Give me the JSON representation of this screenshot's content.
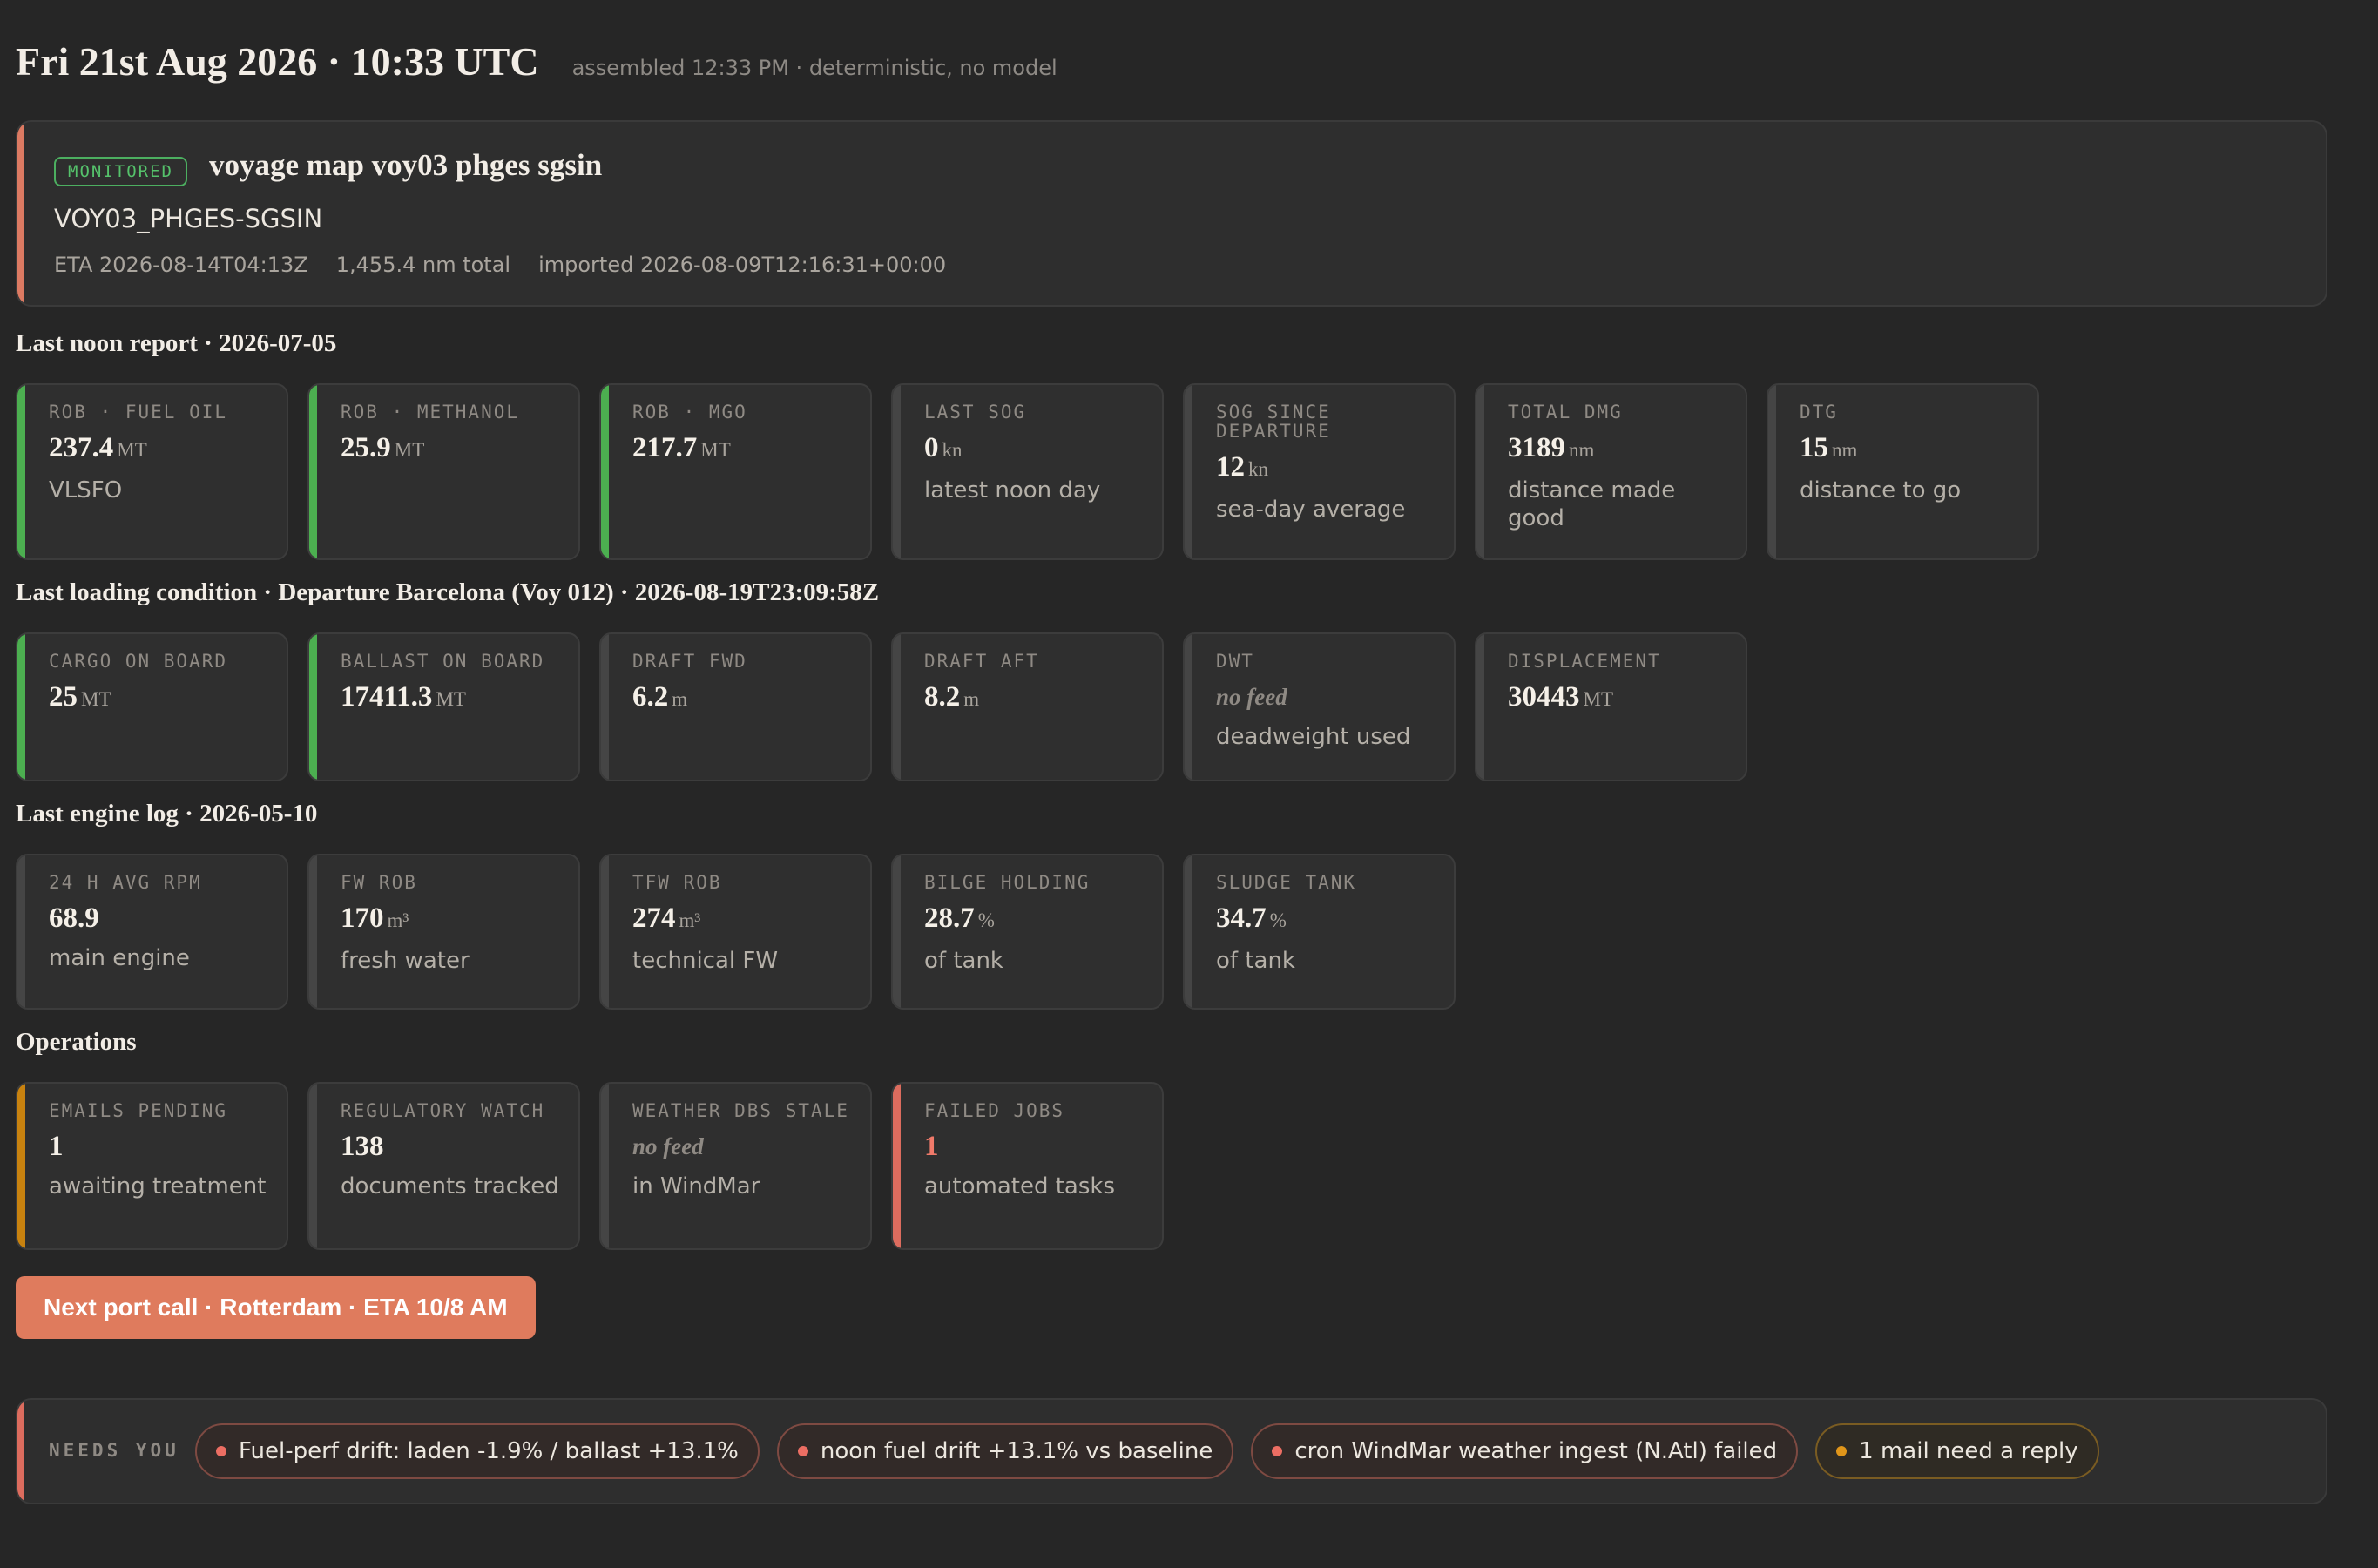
{
  "header": {
    "date": "Fri 21st Aug 2026 · 10:33 UTC",
    "meta": "assembled 12:33 PM · deterministic, no model"
  },
  "voyage": {
    "badge": "MONITORED",
    "title": "voyage map voy03 phges sgsin",
    "id": "VOY03_PHGES-SGSIN",
    "eta": "ETA 2026-08-14T04:13Z",
    "distance": "1,455.4 nm total",
    "imported": "imported 2026-08-09T12:16:31+00:00",
    "accent_color": "#dc7a62"
  },
  "noon": {
    "title": "Last noon report · 2026-07-05",
    "cards": [
      {
        "label": "ROB · FUEL OIL",
        "value": "237.4",
        "unit": "MT",
        "sub": "VLSFO"
      },
      {
        "label": "ROB · METHANOL",
        "value": "25.9",
        "unit": "MT",
        "sub": ""
      },
      {
        "label": "ROB · MGO",
        "value": "217.7",
        "unit": "MT",
        "sub": ""
      },
      {
        "label": "LAST SOG",
        "value": "0",
        "unit": "kn",
        "sub": "latest noon day"
      },
      {
        "label": "SOG SINCE DEPARTURE",
        "value": "12",
        "unit": "kn",
        "sub": "sea-day average"
      },
      {
        "label": "TOTAL DMG",
        "value": "3189",
        "unit": "nm",
        "sub": "distance made good"
      },
      {
        "label": "DTG",
        "value": "15",
        "unit": "nm",
        "sub": "distance to go"
      }
    ]
  },
  "loading": {
    "title": "Last loading condition · Departure Barcelona (Voy 012) · 2026-08-19T23:09:58Z",
    "cards": [
      {
        "label": "CARGO ON BOARD",
        "value": "25",
        "unit": "MT",
        "sub": ""
      },
      {
        "label": "BALLAST ON BOARD",
        "value": "17411.3",
        "unit": "MT",
        "sub": ""
      },
      {
        "label": "DRAFT FWD",
        "value": "6.2",
        "unit": "m",
        "sub": ""
      },
      {
        "label": "DRAFT AFT",
        "value": "8.2",
        "unit": "m",
        "sub": ""
      },
      {
        "label": "DWT",
        "value": "no feed",
        "unit": "",
        "sub": "deadweight used"
      },
      {
        "label": "DISPLACEMENT",
        "value": "30443",
        "unit": "MT",
        "sub": ""
      }
    ]
  },
  "engine": {
    "title": "Last engine log · 2026-05-10",
    "cards": [
      {
        "label": "24 H AVG RPM",
        "value": "68.9",
        "unit": "",
        "sub": "main engine"
      },
      {
        "label": "FW ROB",
        "value": "170",
        "unit": "m³",
        "sub": "fresh water"
      },
      {
        "label": "TFW ROB",
        "value": "274",
        "unit": "m³",
        "sub": "technical FW"
      },
      {
        "label": "BILGE HOLDING",
        "value": "28.7",
        "unit": "%",
        "sub": "of tank"
      },
      {
        "label": "SLUDGE TANK",
        "value": "34.7",
        "unit": "%",
        "sub": "of tank"
      }
    ]
  },
  "operations": {
    "title": "Operations",
    "cards": [
      {
        "label": "EMAILS PENDING",
        "value": "1",
        "unit": "",
        "sub": "awaiting treatment"
      },
      {
        "label": "REGULATORY WATCH",
        "value": "138",
        "unit": "",
        "sub": "documents tracked"
      },
      {
        "label": "WEATHER DBS STALE",
        "value": "no feed",
        "unit": "",
        "sub": "in WindMar"
      },
      {
        "label": "FAILED JOBS",
        "value": "1",
        "unit": "",
        "sub": "automated tasks"
      }
    ]
  },
  "next_port": {
    "label": "Next port call · Rotterdam · ETA 10/8 AM",
    "color": "#df7b5d"
  },
  "needs_you": {
    "label": "NEEDS YOU",
    "chips": [
      {
        "text": "Fuel-perf drift: laden -1.9% / ballast +13.1%",
        "status": "red"
      },
      {
        "text": "noon fuel drift +13.1% vs baseline",
        "status": "red"
      },
      {
        "text": "cron WindMar weather ingest (N.Atl) failed",
        "status": "red"
      },
      {
        "text": "1 mail need a reply",
        "status": "amber"
      }
    ]
  },
  "colors": {
    "background": "#262626",
    "ok": "#4caf50",
    "warn": "#c8820f",
    "alert": "#dc6c5e"
  }
}
